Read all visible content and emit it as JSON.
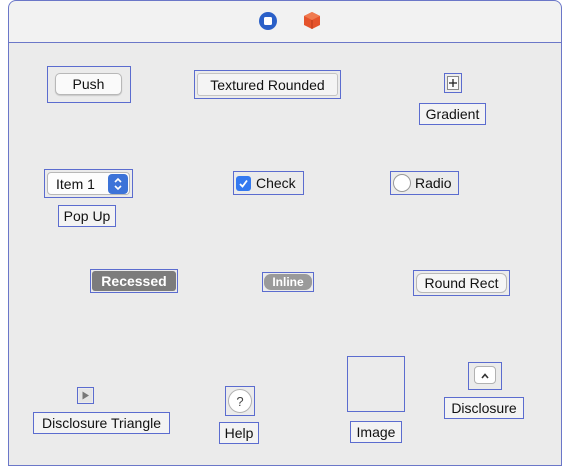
{
  "toolbar": {
    "icons": [
      "stop-icon",
      "cube-object-icon"
    ],
    "colors": {
      "stop": "#2b60c8",
      "object": "#e5532b"
    }
  },
  "controls": {
    "push": "Push",
    "textured_rounded": "Textured Rounded",
    "gradient": "Gradient",
    "popup_value": "Item 1",
    "popup_label": "Pop Up",
    "check": "Check",
    "radio": "Radio",
    "recessed": "Recessed",
    "inline": "Inline",
    "round_rect": "Round Rect",
    "disclosure_triangle": "Disclosure Triangle",
    "help_symbol": "?",
    "help": "Help",
    "image": "Image",
    "disclosure": "Disclosure"
  },
  "colors": {
    "selection": "#5b6ccf",
    "canvas": "#ebebeb",
    "accent": "#3479f0"
  }
}
